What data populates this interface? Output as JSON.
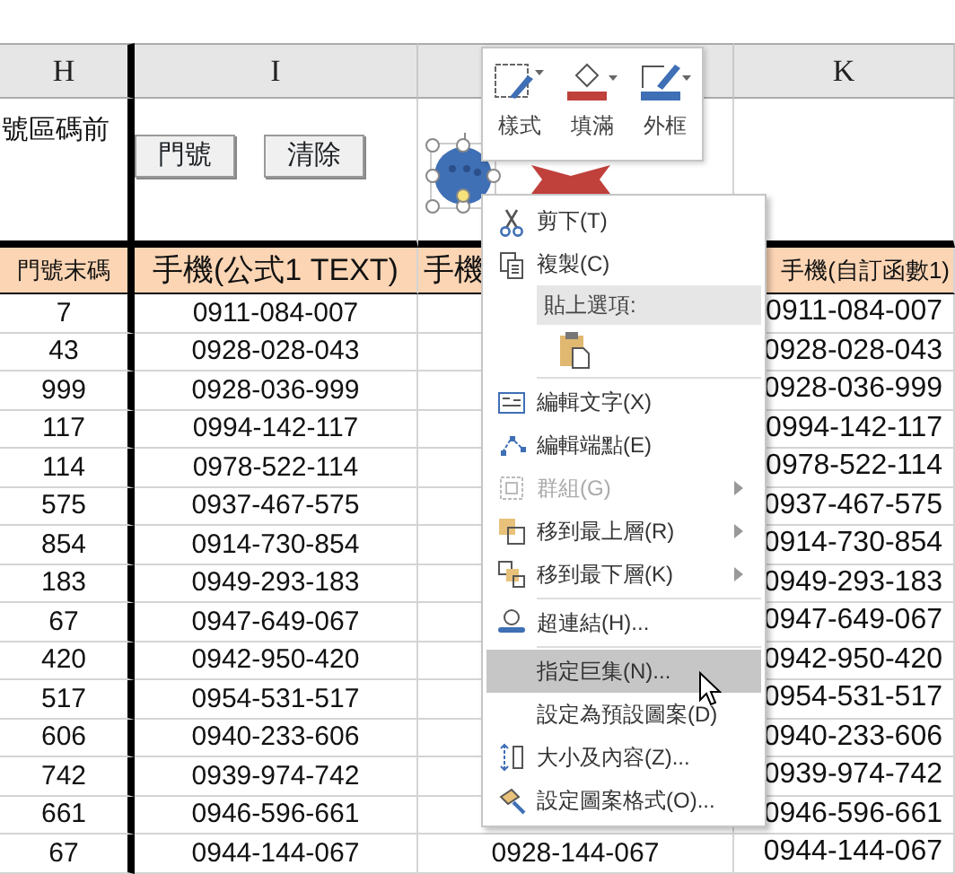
{
  "column_headers": {
    "h": "H",
    "i": "I",
    "k": "K"
  },
  "top_row": {
    "note": "號區碼前",
    "buttons": [
      "門號",
      "清除"
    ]
  },
  "header_row": [
    "門號末碼",
    "手機(公式1 TEXT)",
    "手機",
    "手機(自訂函數1)"
  ],
  "rows": [
    {
      "h": "7",
      "i": "0911-084-007",
      "k": "0911-084-007"
    },
    {
      "h": "43",
      "i": "0928-028-043",
      "k": "0928-028-043"
    },
    {
      "h": "999",
      "i": "0928-036-999",
      "k": "0928-036-999"
    },
    {
      "h": "117",
      "i": "0994-142-117",
      "k": "0994-142-117"
    },
    {
      "h": "114",
      "i": "0978-522-114",
      "k": "0978-522-114"
    },
    {
      "h": "575",
      "i": "0937-467-575",
      "k": "0937-467-575"
    },
    {
      "h": "854",
      "i": "0914-730-854",
      "k": "0914-730-854"
    },
    {
      "h": "183",
      "i": "0949-293-183",
      "k": "0949-293-183"
    },
    {
      "h": "67",
      "i": "0947-649-067",
      "k": "0947-649-067"
    },
    {
      "h": "420",
      "i": "0942-950-420",
      "k": "0942-950-420"
    },
    {
      "h": "517",
      "i": "0954-531-517",
      "k": "0954-531-517"
    },
    {
      "h": "606",
      "i": "0940-233-606",
      "k": "0940-233-606"
    },
    {
      "h": "742",
      "i": "0939-974-742",
      "k": "0939-974-742"
    },
    {
      "h": "661",
      "i": "0946-596-661",
      "k": "0946-596-661"
    },
    {
      "h": "67",
      "i": "0944-144-067",
      "j": "0928-144-067",
      "k": "0944-144-067"
    }
  ],
  "mini_toolbar": [
    {
      "label": "樣式"
    },
    {
      "label": "填滿"
    },
    {
      "label": "外框"
    }
  ],
  "context_menu": [
    {
      "kind": "item",
      "label": "剪下(T)",
      "disabled": false,
      "submenu": false,
      "selected": false
    },
    {
      "kind": "item",
      "label": "複製(C)",
      "disabled": false,
      "submenu": false,
      "selected": false
    },
    {
      "kind": "header",
      "label": "貼上選項:"
    },
    {
      "kind": "paste"
    },
    {
      "kind": "separator"
    },
    {
      "kind": "item",
      "label": "編輯文字(X)",
      "disabled": false,
      "submenu": false,
      "selected": false
    },
    {
      "kind": "item",
      "label": "編輯端點(E)",
      "disabled": false,
      "submenu": false,
      "selected": false
    },
    {
      "kind": "item",
      "label": "群組(G)",
      "disabled": true,
      "submenu": true,
      "selected": false
    },
    {
      "kind": "item",
      "label": "移到最上層(R)",
      "disabled": false,
      "submenu": true,
      "selected": false
    },
    {
      "kind": "item",
      "label": "移到最下層(K)",
      "disabled": false,
      "submenu": true,
      "selected": false
    },
    {
      "kind": "separator"
    },
    {
      "kind": "item",
      "label": "超連結(H)...",
      "disabled": false,
      "submenu": false,
      "selected": false
    },
    {
      "kind": "separator"
    },
    {
      "kind": "item",
      "label": "指定巨集(N)...",
      "disabled": false,
      "submenu": false,
      "selected": true
    },
    {
      "kind": "item",
      "label": "設定為預設圖案(D)",
      "disabled": false,
      "submenu": false,
      "selected": false
    },
    {
      "kind": "item",
      "label": "大小及內容(Z)...",
      "disabled": false,
      "submenu": false,
      "selected": false
    },
    {
      "kind": "item",
      "label": "設定圖案格式(O)...",
      "disabled": false,
      "submenu": false,
      "selected": false
    }
  ]
}
